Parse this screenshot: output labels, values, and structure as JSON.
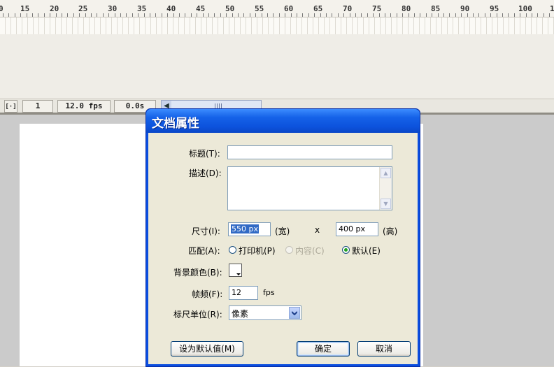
{
  "timeline": {
    "ruler_numbers": [
      "0",
      "15",
      "20",
      "25",
      "30",
      "35",
      "40",
      "45",
      "50",
      "55",
      "60",
      "65",
      "70",
      "75",
      "80",
      "85",
      "90",
      "95",
      "100",
      "1"
    ]
  },
  "statusbar": {
    "center_icon": "center-frame-icon",
    "current_frame": "1",
    "frame_rate": "12.0 fps",
    "elapsed_time": "0.0s"
  },
  "dialog": {
    "title": "文档属性",
    "title_label": "标题(T):",
    "title_value": "",
    "description_label": "描述(D):",
    "description_value": "",
    "dimensions_label": "尺寸(I):",
    "width_value": "550 px",
    "width_unit": "(宽)",
    "times": "x",
    "height_value": "400 px",
    "height_unit": "(高)",
    "match_label": "匹配(A):",
    "match_printer": "打印机(P)",
    "match_contents": "内容(C)",
    "match_default": "默认(E)",
    "match_selected": "default",
    "bg_color_label": "背景颜色(B):",
    "bg_color": "#ffffff",
    "frame_rate_label": "帧频(F):",
    "frame_rate_value": "12",
    "frame_rate_unit": "fps",
    "ruler_units_label": "标尺单位(R):",
    "ruler_units_value": "像素",
    "make_default_button": "设为默认值(M)",
    "ok_button": "确定",
    "cancel_button": "取消"
  },
  "colors": {
    "titlebar": "#0c52dc",
    "dialog_bg": "#ece9d8",
    "stage": "#ffffff",
    "workspace": "#cbcbcb"
  }
}
